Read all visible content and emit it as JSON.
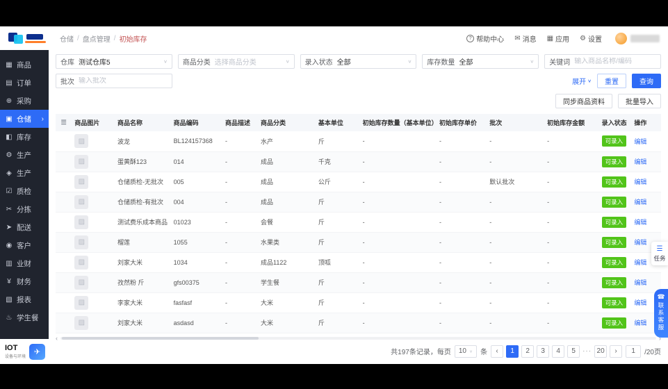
{
  "colors": {
    "primary": "#2E6BF6",
    "success": "#52C41A",
    "sidebar_bg": "#20242E",
    "breadcrumb_active": "#C45656"
  },
  "icons": {
    "chevron_down": "∨",
    "chevron_right": "›",
    "help": "?",
    "message": "✉",
    "apps": "▦",
    "gear": "⚙",
    "column_settings": "☰",
    "image_placeholder": "▨",
    "task": "☰",
    "support": "☎",
    "iot": "✈",
    "prev": "‹",
    "next": "›",
    "scroll_left": "‹",
    "scroll_right": "›"
  },
  "topbar": {
    "breadcrumb": [
      "仓储",
      "盘点管理",
      "初始库存"
    ],
    "separator": "/",
    "help": "帮助中心",
    "messages": "消息",
    "apps": "应用",
    "settings": "设置"
  },
  "sidebar": {
    "items": [
      {
        "id": "goods",
        "label": "商品",
        "icon": "grid-icon",
        "glyph": "▦"
      },
      {
        "id": "orders",
        "label": "订单",
        "icon": "document-icon",
        "glyph": "▤"
      },
      {
        "id": "purchase",
        "label": "采购",
        "icon": "cart-icon",
        "glyph": "⊕"
      },
      {
        "id": "warehouse",
        "label": "仓储",
        "icon": "box-icon",
        "glyph": "▣",
        "active": true
      },
      {
        "id": "inventory",
        "label": "库存",
        "icon": "stock-icon",
        "glyph": "◧"
      },
      {
        "id": "production-1",
        "label": "生产",
        "icon": "gear-icon",
        "glyph": "⚙"
      },
      {
        "id": "production-2",
        "label": "生产",
        "icon": "factory-icon",
        "glyph": "◈"
      },
      {
        "id": "quality",
        "label": "质检",
        "icon": "check-icon",
        "glyph": "☑"
      },
      {
        "id": "sorting",
        "label": "分拣",
        "icon": "scissors-icon",
        "glyph": "✂"
      },
      {
        "id": "delivery",
        "label": "配送",
        "icon": "truck-icon",
        "glyph": "➤"
      },
      {
        "id": "customer",
        "label": "客户",
        "icon": "user-icon",
        "glyph": "◉"
      },
      {
        "id": "business-finance",
        "label": "业财",
        "icon": "ledger-icon",
        "glyph": "▥"
      },
      {
        "id": "finance",
        "label": "财务",
        "icon": "yuan-icon",
        "glyph": "¥"
      },
      {
        "id": "reports",
        "label": "报表",
        "icon": "chart-icon",
        "glyph": "▧"
      },
      {
        "id": "student-meal",
        "label": "学生餐",
        "icon": "meal-icon",
        "glyph": "♨"
      }
    ],
    "footer": {
      "title": "IOT",
      "subtitle": "设备与环境"
    }
  },
  "filters": {
    "warehouse": {
      "label": "仓库",
      "value": "测试仓库5"
    },
    "category": {
      "label": "商品分类",
      "placeholder": "选择商品分类"
    },
    "entry_status": {
      "label": "录入状态",
      "value": "全部"
    },
    "stock_qty": {
      "label": "库存数量",
      "value": "全部"
    },
    "keyword": {
      "label": "关键词",
      "placeholder": "输入商品名称/编码"
    },
    "batch": {
      "label": "批次",
      "placeholder": "输入批次"
    },
    "expand": "展开",
    "reset": "重置",
    "search": "查询"
  },
  "toolbar": {
    "sync": "同步商品资料",
    "import": "批量导入"
  },
  "table": {
    "columns": [
      "商品图片",
      "商品名称",
      "商品编码",
      "商品描述",
      "商品分类",
      "基本单位",
      "初始库存数量（基本单位）",
      "初始库存单价",
      "批次",
      "初始库存金额",
      "录入状态",
      "操作"
    ],
    "rows": [
      {
        "name": "波龙",
        "code": "BL124157368",
        "desc": "-",
        "category": "水产",
        "unit": "斤",
        "qty": "-",
        "price": "-",
        "batch": "-",
        "amount": "-",
        "status": "可录入",
        "action": "编辑"
      },
      {
        "name": "蛋黄酥123",
        "code": "014",
        "desc": "-",
        "category": "成品",
        "unit": "千克",
        "qty": "-",
        "price": "-",
        "batch": "-",
        "amount": "-",
        "status": "可录入",
        "action": "编辑"
      },
      {
        "name": "仓储质检-无批次",
        "code": "005",
        "desc": "-",
        "category": "成品",
        "unit": "公斤",
        "qty": "-",
        "price": "-",
        "batch": "默认批次",
        "amount": "-",
        "status": "可录入",
        "action": "编辑"
      },
      {
        "name": "仓储质检-有批次",
        "code": "004",
        "desc": "-",
        "category": "成品",
        "unit": "斤",
        "qty": "-",
        "price": "-",
        "batch": "-",
        "amount": "-",
        "status": "可录入",
        "action": "编辑"
      },
      {
        "name": "测试费乐成本商品",
        "code": "01023",
        "desc": "-",
        "category": "会餐",
        "unit": "斤",
        "qty": "-",
        "price": "-",
        "batch": "-",
        "amount": "-",
        "status": "可录入",
        "action": "编辑"
      },
      {
        "name": "榴莲",
        "code": "1055",
        "desc": "-",
        "category": "水果类",
        "unit": "斤",
        "qty": "-",
        "price": "-",
        "batch": "-",
        "amount": "-",
        "status": "可录入",
        "action": "编辑"
      },
      {
        "name": "刘家大米",
        "code": "1034",
        "desc": "-",
        "category": "成品1122",
        "unit": "顶呱",
        "qty": "-",
        "price": "-",
        "batch": "-",
        "amount": "-",
        "status": "可录入",
        "action": "编辑"
      },
      {
        "name": "孜然粉 斤",
        "code": "gfs00375",
        "desc": "-",
        "category": "学生餐",
        "unit": "斤",
        "qty": "-",
        "price": "-",
        "batch": "-",
        "amount": "-",
        "status": "可录入",
        "action": "编辑"
      },
      {
        "name": "李家大米",
        "code": "fasfasf",
        "desc": "-",
        "category": "大米",
        "unit": "斤",
        "qty": "-",
        "price": "-",
        "batch": "-",
        "amount": "-",
        "status": "可录入",
        "action": "编辑"
      },
      {
        "name": "刘家大米",
        "code": "asdasd",
        "desc": "-",
        "category": "大米",
        "unit": "斤",
        "qty": "-",
        "price": "-",
        "batch": "-",
        "amount": "-",
        "status": "可录入",
        "action": "编辑"
      }
    ]
  },
  "pagination": {
    "summary": "共197条记录，每页",
    "page_size": "10",
    "unit": "条",
    "pages": [
      "1",
      "2",
      "3",
      "4",
      "5"
    ],
    "current": "1",
    "ellipsis": "···",
    "last_page": "20",
    "jump_value": "1",
    "jump_suffix": "/20页"
  },
  "floating": {
    "task": "任务",
    "support": "联系客服"
  }
}
